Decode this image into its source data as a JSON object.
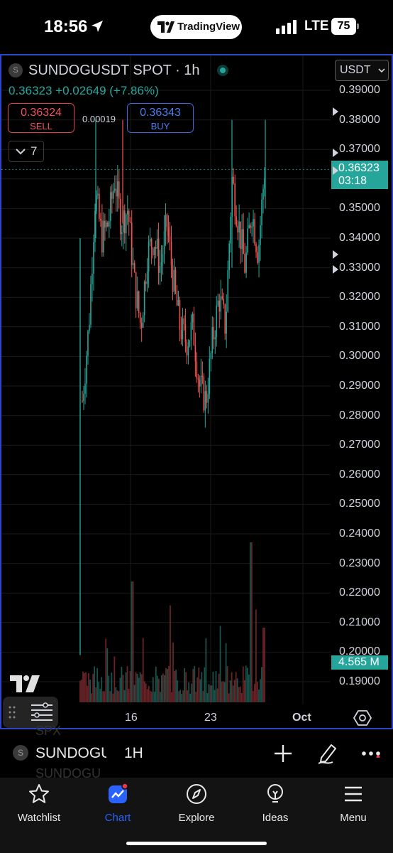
{
  "status_bar": {
    "time": "18:56",
    "app_pill": "TradingView",
    "network": "LTE",
    "battery": "75"
  },
  "chart": {
    "symbol_title": "SUNDOGUSDT SPOT · 1h",
    "symbol_icon_letter": "S",
    "last_price_line": "0.36323 +0.02649 (+7.86%)",
    "sell_price": "0.36324",
    "sell_label": "SELL",
    "spread": "0.00019",
    "buy_price": "0.36343",
    "buy_label": "BUY",
    "indicators_count": "7",
    "currency": "USDT",
    "current_price": "0.36323",
    "countdown": "03:18",
    "volume_tag": "4.565 M",
    "x_labels": [
      "16",
      "23",
      "Oct"
    ],
    "colors": {
      "up": "#26a69a",
      "down": "#ef5350",
      "accent": "#2962ff",
      "frame": "#2d45c8"
    }
  },
  "chart_data": {
    "type": "candlestick",
    "title": "SUNDOGUSDT SPOT · 1h",
    "y_ticks": [
      "0.39000",
      "0.38000",
      "0.37000",
      "0.36000",
      "0.35000",
      "0.34000",
      "0.33000",
      "0.32000",
      "0.31000",
      "0.30000",
      "0.29000",
      "0.28000",
      "0.27000",
      "0.26000",
      "0.25000",
      "0.24000",
      "0.23000",
      "0.22000",
      "0.21000",
      "0.20000",
      "0.19000"
    ],
    "x_ticks": [
      "16",
      "23",
      "Oct"
    ],
    "ylim": [
      0.186,
      0.392
    ],
    "last_price": 0.36323,
    "volume_last": "4.565 M",
    "close_path": [
      {
        "x": "Sep 12",
        "y": 0.285
      },
      {
        "x": "Sep 12",
        "y": 0.31
      },
      {
        "x": "Sep 13",
        "y": 0.355
      },
      {
        "x": "Sep 13",
        "y": 0.34
      },
      {
        "x": "Sep 14",
        "y": 0.345
      },
      {
        "x": "Sep 14",
        "y": 0.36
      },
      {
        "x": "Sep 15",
        "y": 0.345
      },
      {
        "x": "Sep 15",
        "y": 0.35
      },
      {
        "x": "Sep 16",
        "y": 0.325
      },
      {
        "x": "Sep 17",
        "y": 0.31
      },
      {
        "x": "Sep 17",
        "y": 0.335
      },
      {
        "x": "Sep 18",
        "y": 0.34
      },
      {
        "x": "Sep 18",
        "y": 0.33
      },
      {
        "x": "Sep 19",
        "y": 0.345
      },
      {
        "x": "Sep 19",
        "y": 0.325
      },
      {
        "x": "Sep 20",
        "y": 0.31
      },
      {
        "x": "Sep 21",
        "y": 0.305
      },
      {
        "x": "Sep 21",
        "y": 0.31
      },
      {
        "x": "Sep 22",
        "y": 0.29
      },
      {
        "x": "Sep 22",
        "y": 0.285
      },
      {
        "x": "Sep 23",
        "y": 0.305
      },
      {
        "x": "Sep 23",
        "y": 0.32
      },
      {
        "x": "Sep 24",
        "y": 0.31
      },
      {
        "x": "Sep 24",
        "y": 0.36
      },
      {
        "x": "Sep 25",
        "y": 0.345
      },
      {
        "x": "Sep 25",
        "y": 0.33
      },
      {
        "x": "Sep 26",
        "y": 0.35
      },
      {
        "x": "Sep 26",
        "y": 0.335
      },
      {
        "x": "Sep 27",
        "y": 0.36323
      }
    ]
  },
  "toolbar": {
    "symbol": "SUNDOGUSDT",
    "timeframe": "1H",
    "ghost_top": "SPX",
    "ghost_bottom": "SUNDOGU"
  },
  "tabs": [
    {
      "label": "Watchlist",
      "icon": "star-icon"
    },
    {
      "label": "Chart",
      "icon": "chart-icon"
    },
    {
      "label": "Explore",
      "icon": "compass-icon"
    },
    {
      "label": "Ideas",
      "icon": "lightbulb-icon"
    },
    {
      "label": "Menu",
      "icon": "menu-icon"
    }
  ]
}
